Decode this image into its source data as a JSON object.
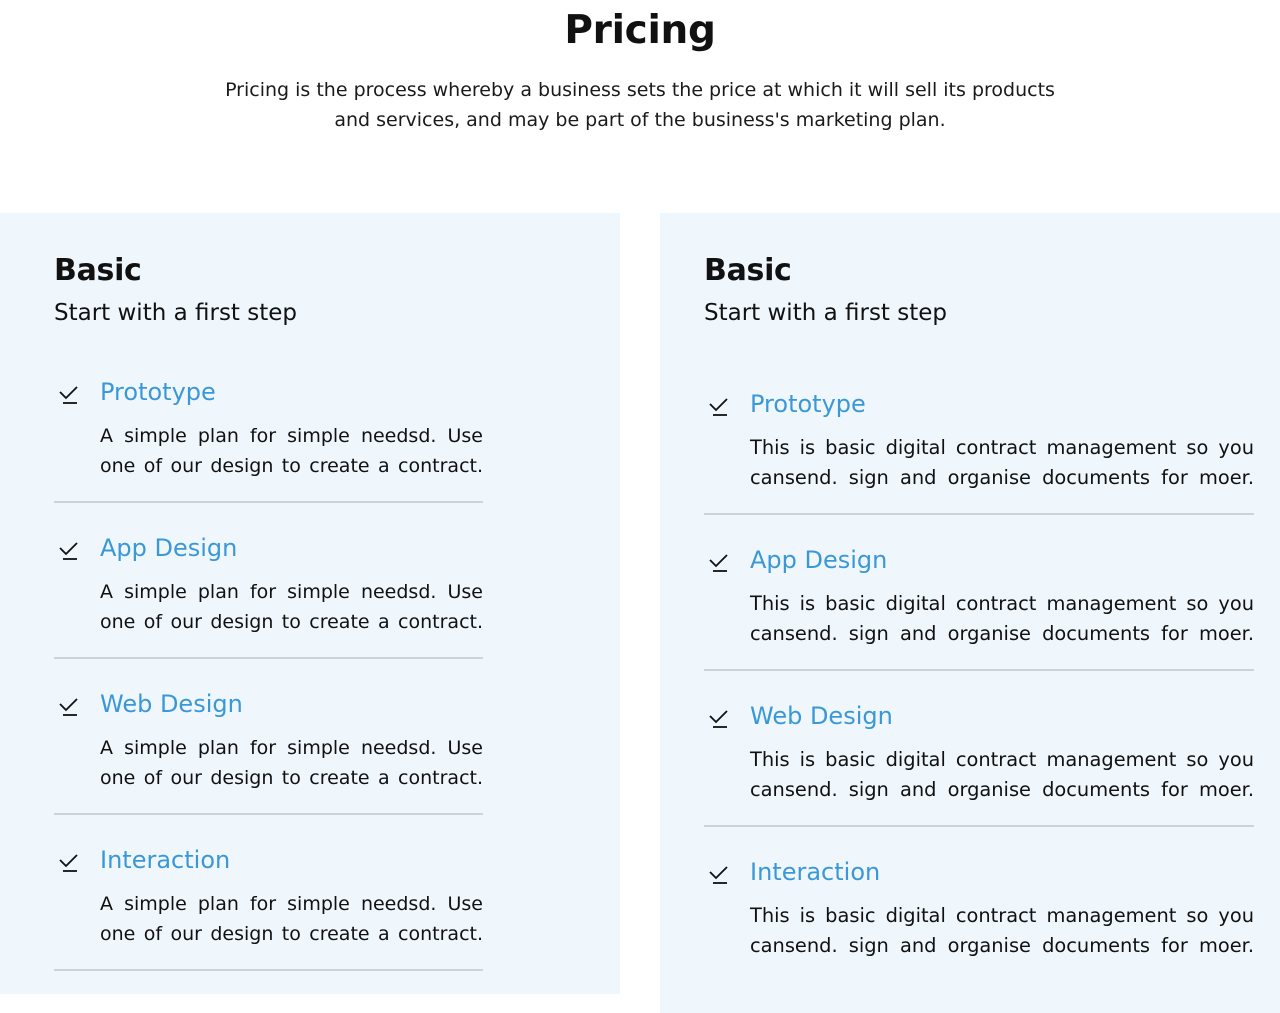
{
  "header": {
    "title": "Pricing",
    "subtitle_line1": "Pricing is the process whereby a business sets the price at which it will sell its products",
    "subtitle_line2": "and services, and may be part of the business's marketing plan."
  },
  "colors": {
    "accent": "#3b98d7",
    "card_background": "#eff6fc",
    "divider": "#cfd3d6",
    "text": "#111111"
  },
  "icons": {
    "feature_marker": "check-icon"
  },
  "cards": [
    {
      "title": "Basic",
      "tagline": "Start with a first step",
      "features": [
        {
          "name": "Prototype",
          "desc_line1": "A simple plan for simple needsd. Use",
          "desc_line2": "one of our design to create a contract."
        },
        {
          "name": "App Design",
          "desc_line1": "A simple plan for simple needsd. Use",
          "desc_line2": "one of our design to create a contract."
        },
        {
          "name": "Web Design",
          "desc_line1": "A simple plan for simple needsd. Use",
          "desc_line2": "one of our design to create a contract."
        },
        {
          "name": "Interaction",
          "desc_line1": "A simple plan for simple needsd. Use",
          "desc_line2": "one of our design to create a contract."
        }
      ]
    },
    {
      "title": "Basic",
      "tagline": "Start with a first step",
      "features": [
        {
          "name": "Prototype",
          "desc_line1": "This is basic digital contract management so you",
          "desc_line2": "cansend. sign and organise documents for moer."
        },
        {
          "name": "App Design",
          "desc_line1": "This is basic digital contract management so you",
          "desc_line2": "cansend. sign and organise documents for moer."
        },
        {
          "name": "Web Design",
          "desc_line1": "This is basic digital contract management so you",
          "desc_line2": "cansend. sign and organise documents for moer."
        },
        {
          "name": "Interaction",
          "desc_line1": "This is basic digital contract management so you",
          "desc_line2": "cansend. sign and organise documents for moer."
        }
      ]
    }
  ]
}
